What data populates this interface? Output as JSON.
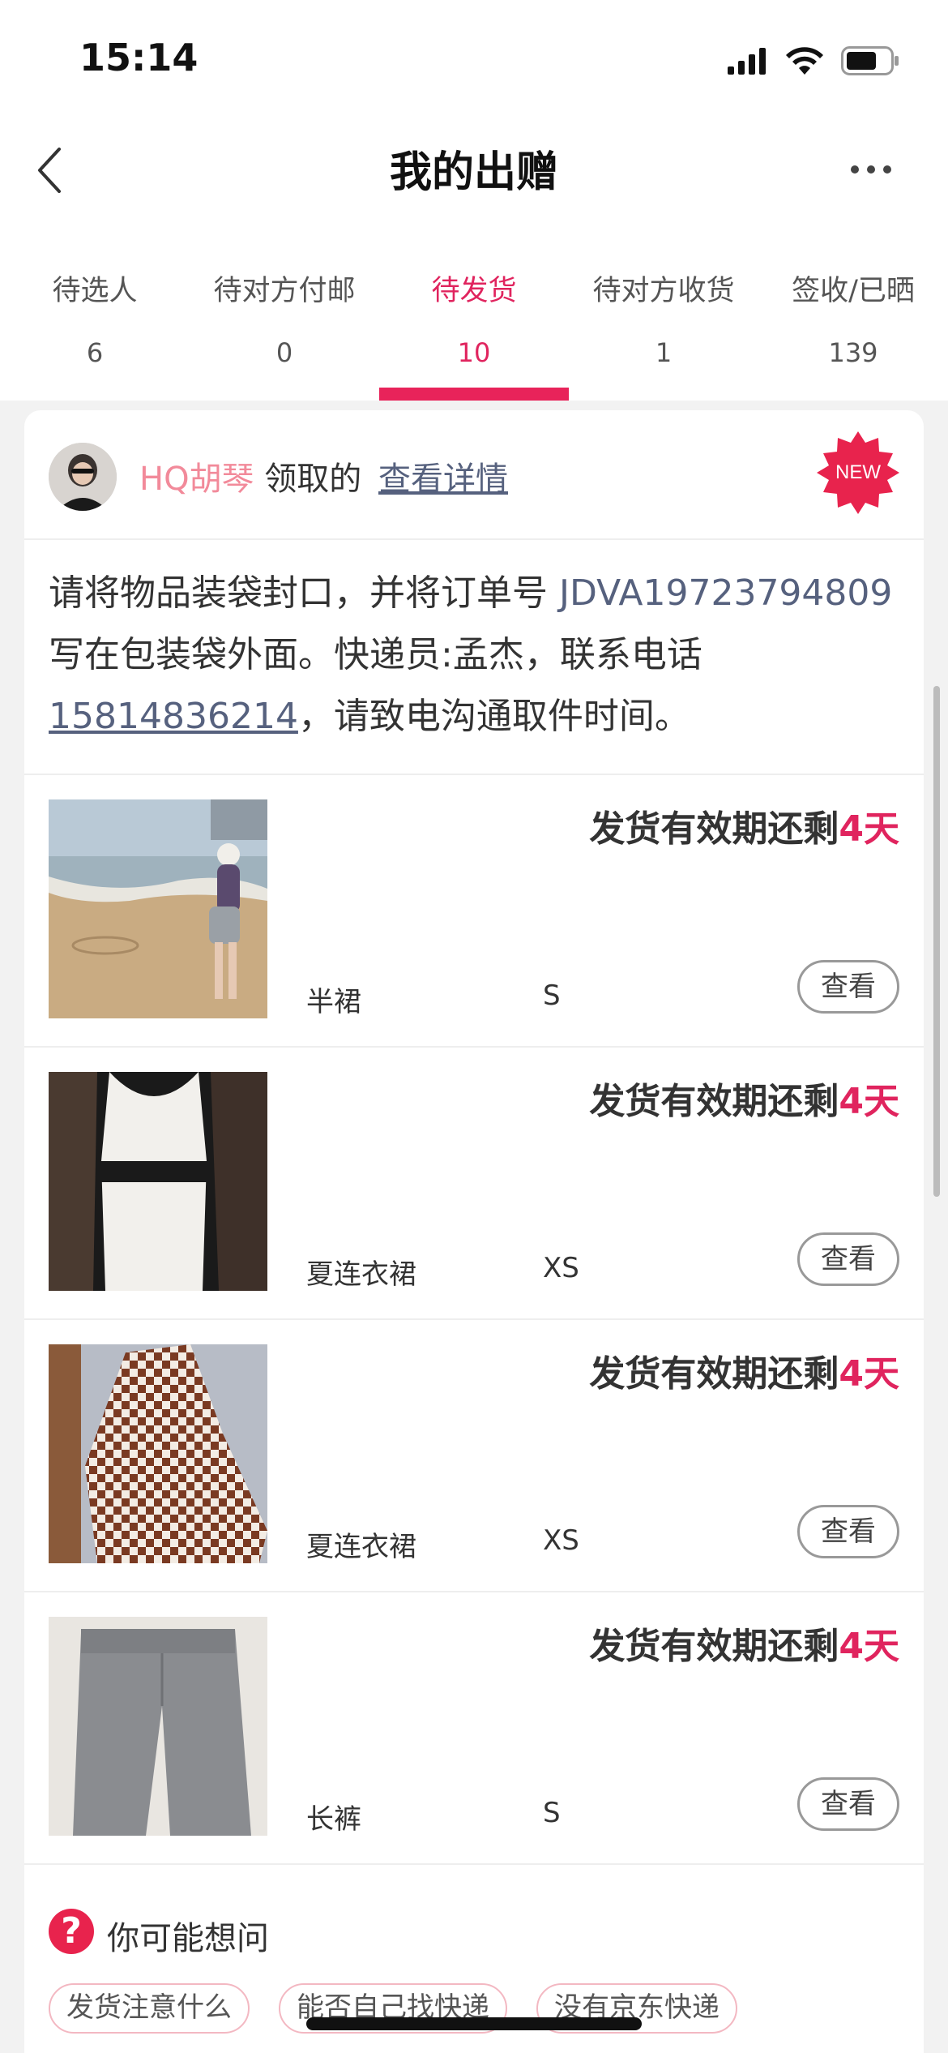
{
  "status_bar": {
    "time": "15:14"
  },
  "nav": {
    "title": "我的出赠"
  },
  "tabs": [
    {
      "label": "待选人",
      "count": "6",
      "active": false
    },
    {
      "label": "待对方付邮",
      "count": "0",
      "active": false
    },
    {
      "label": "待发货",
      "count": "10",
      "active": true
    },
    {
      "label": "待对方收货",
      "count": "1",
      "active": false
    },
    {
      "label": "签收/已晒",
      "count": "139",
      "active": false
    }
  ],
  "giver": {
    "name": "HQ胡琴",
    "suffix": "领取的",
    "detail_link": "查看详情",
    "badge": "NEW"
  },
  "instructions": {
    "part1": "请将物品装袋封口，并将订单号 ",
    "order_no": "JDVA19723794809",
    "part2": " 写在包装袋外面。快递员:孟杰，联系电话",
    "phone": "15814836214",
    "part3": "，请致电沟通取件时间。"
  },
  "items": [
    {
      "name": "半裙",
      "size": "S",
      "deadline_prefix": "发货有效期还剩",
      "deadline_days": "4天",
      "view_label": "查看"
    },
    {
      "name": "夏连衣裙",
      "size": "XS",
      "deadline_prefix": "发货有效期还剩",
      "deadline_days": "4天",
      "view_label": "查看"
    },
    {
      "name": "夏连衣裙",
      "size": "XS",
      "deadline_prefix": "发货有效期还剩",
      "deadline_days": "4天",
      "view_label": "查看"
    },
    {
      "name": "长裤",
      "size": "S",
      "deadline_prefix": "发货有效期还剩",
      "deadline_days": "4天",
      "view_label": "查看"
    }
  ],
  "faq": {
    "icon_text": "?",
    "title": "你可能想问",
    "chips": [
      "发货注意什么",
      "能否自己找快递",
      "没有京东快递"
    ]
  },
  "colors": {
    "accent": "#e8235a",
    "link": "#56617e",
    "name_pink": "#f28a9a"
  }
}
